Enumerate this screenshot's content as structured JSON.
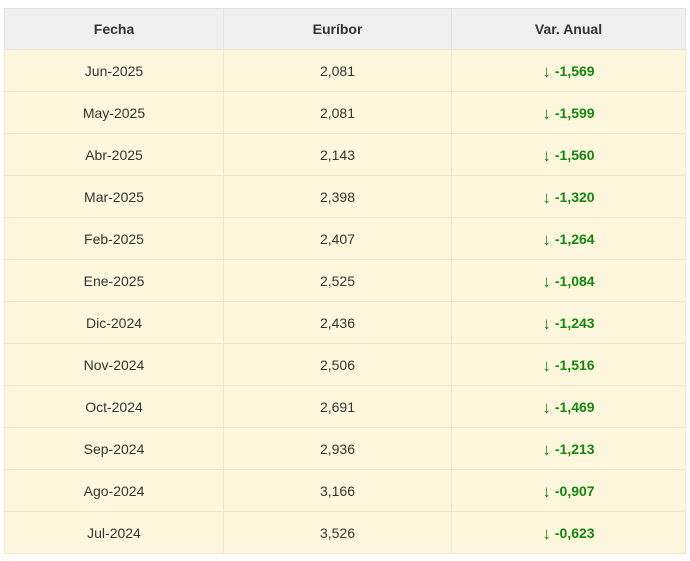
{
  "table": {
    "headers": [
      "Fecha",
      "Euríbor",
      "Var. Anual"
    ],
    "colors": {
      "header_bg": "#f0f0f0",
      "row_bg": "#fff7dd",
      "down_color": "#13870f"
    },
    "arrow_icon": "arrow-down-icon",
    "arrow_glyph": "↓",
    "rows": [
      {
        "fecha": "Jun-2025",
        "euribor": "2,081",
        "var": "-1,569"
      },
      {
        "fecha": "May-2025",
        "euribor": "2,081",
        "var": "-1,599"
      },
      {
        "fecha": "Abr-2025",
        "euribor": "2,143",
        "var": "-1,560"
      },
      {
        "fecha": "Mar-2025",
        "euribor": "2,398",
        "var": "-1,320"
      },
      {
        "fecha": "Feb-2025",
        "euribor": "2,407",
        "var": "-1,264"
      },
      {
        "fecha": "Ene-2025",
        "euribor": "2,525",
        "var": "-1,084"
      },
      {
        "fecha": "Dic-2024",
        "euribor": "2,436",
        "var": "-1,243"
      },
      {
        "fecha": "Nov-2024",
        "euribor": "2,506",
        "var": "-1,516"
      },
      {
        "fecha": "Oct-2024",
        "euribor": "2,691",
        "var": "-1,469"
      },
      {
        "fecha": "Sep-2024",
        "euribor": "2,936",
        "var": "-1,213"
      },
      {
        "fecha": "Ago-2024",
        "euribor": "3,166",
        "var": "-0,907"
      },
      {
        "fecha": "Jul-2024",
        "euribor": "3,526",
        "var": "-0,623"
      }
    ]
  }
}
